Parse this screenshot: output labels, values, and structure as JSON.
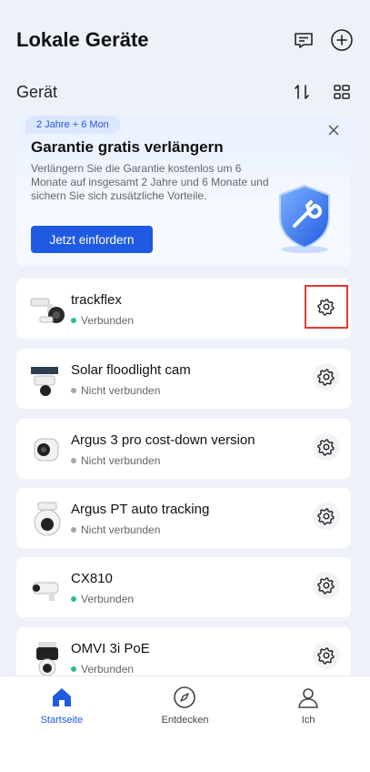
{
  "header": {
    "title": "Lokale Geräte"
  },
  "section": {
    "title": "Gerät"
  },
  "promo": {
    "badge": "2 Jahre + 6 Mon",
    "title": "Garantie gratis verlängern",
    "text": "Verlängern Sie die Garantie kostenlos um 6 Monate auf insgesamt 2 Jahre und 6 Monate und sichern Sie sich zusätzliche Vorteile.",
    "button": "Jetzt einfordern"
  },
  "devices": [
    {
      "name": "trackflex",
      "status": "Verbunden",
      "connected": true
    },
    {
      "name": "Solar floodlight cam",
      "status": "Nicht verbunden",
      "connected": false
    },
    {
      "name": "Argus 3 pro cost-down version",
      "status": "Nicht verbunden",
      "connected": false
    },
    {
      "name": "Argus PT auto tracking",
      "status": "Nicht verbunden",
      "connected": false
    },
    {
      "name": "CX810",
      "status": "Verbunden",
      "connected": true
    },
    {
      "name": "OMVI 3i PoE",
      "status": "Verbunden",
      "connected": true
    }
  ],
  "nav": [
    {
      "label": "Startseite",
      "icon": "home-icon",
      "active": true
    },
    {
      "label": "Entdecken",
      "icon": "compass-icon",
      "active": false
    },
    {
      "label": "Ich",
      "icon": "user-icon",
      "active": false
    }
  ],
  "colors": {
    "accent": "#1f5ae3",
    "connected": "#2bbf8a",
    "disconnected": "#a0a4ab",
    "highlight": "#e53935"
  }
}
